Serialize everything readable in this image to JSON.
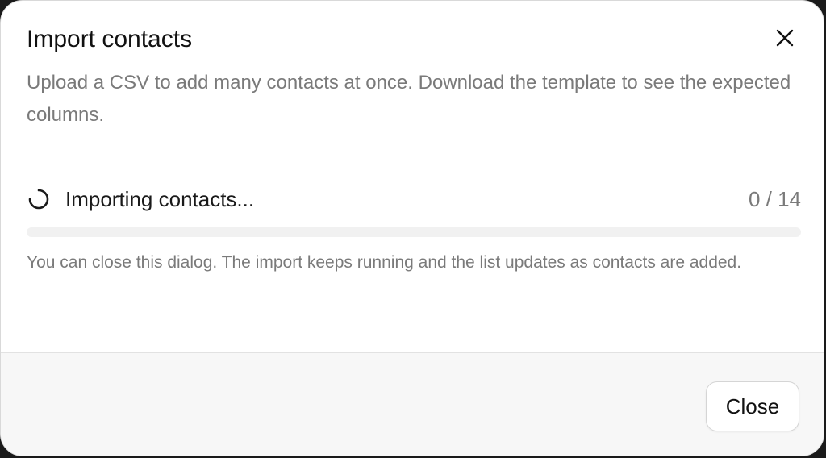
{
  "dialog": {
    "title": "Import contacts",
    "description": "Upload a CSV to add many contacts at once. Download the template to see the expected columns.",
    "close_icon": "close-icon"
  },
  "import_status": {
    "label": "Importing contacts...",
    "count": "0 / 14",
    "progress": 0,
    "spinner_icon": "spinner-icon"
  },
  "note": "You can close this dialog. The import keeps running and the list updates as contacts are added.",
  "footer": {
    "close_label": "Close"
  },
  "colors": {
    "title": "#111111",
    "muted_text": "#7a7a7a",
    "track": "#f1f1f1",
    "footer_bg": "#f7f7f7"
  }
}
